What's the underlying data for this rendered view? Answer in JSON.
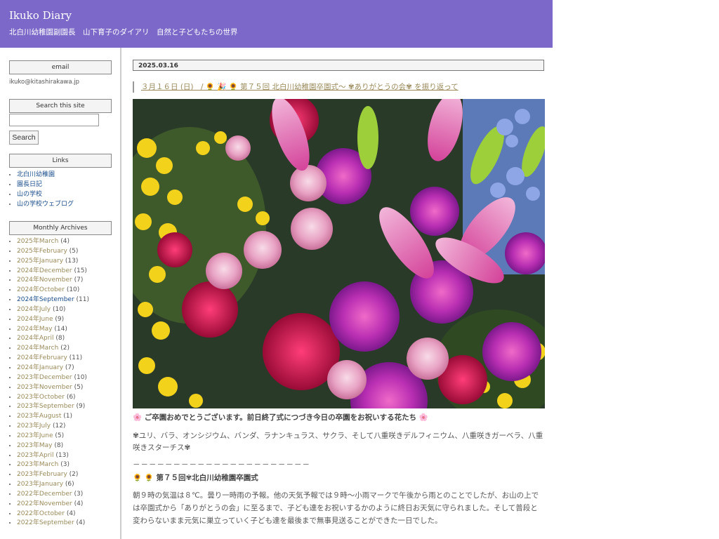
{
  "header": {
    "title": "Ikuko Diary",
    "tagline": "北白川幼稚園副園長　山下育子のダイアリ　自然と子どもたちの世界"
  },
  "sidebar": {
    "email": {
      "heading": "email",
      "address": "ikuko@kitashirakawa.jp"
    },
    "search": {
      "heading": "Search this site",
      "button": "Search",
      "value": ""
    },
    "links": {
      "heading": "Links",
      "items": [
        "北白川幼稚園",
        "園長日記",
        "山の学校",
        "山の学校ウェブログ"
      ]
    },
    "archives": {
      "heading": "Monthly Archives",
      "items": [
        {
          "label": "2025年March",
          "count": "(4)"
        },
        {
          "label": "2025年February",
          "count": "(5)"
        },
        {
          "label": "2025年January",
          "count": "(13)"
        },
        {
          "label": "2024年December",
          "count": "(15)"
        },
        {
          "label": "2024年November",
          "count": "(7)"
        },
        {
          "label": "2024年October",
          "count": "(10)"
        },
        {
          "label": "2024年September",
          "count": "(11)"
        },
        {
          "label": "2024年July",
          "count": "(10)"
        },
        {
          "label": "2024年June",
          "count": "(9)"
        },
        {
          "label": "2024年May",
          "count": "(14)"
        },
        {
          "label": "2024年April",
          "count": "(8)"
        },
        {
          "label": "2024年March",
          "count": "(2)"
        },
        {
          "label": "2024年February",
          "count": "(11)"
        },
        {
          "label": "2024年January",
          "count": "(7)"
        },
        {
          "label": "2023年December",
          "count": "(10)"
        },
        {
          "label": "2023年November",
          "count": "(5)"
        },
        {
          "label": "2023年October",
          "count": "(6)"
        },
        {
          "label": "2023年September",
          "count": "(9)"
        },
        {
          "label": "2023年August",
          "count": "(1)"
        },
        {
          "label": "2023年July",
          "count": "(12)"
        },
        {
          "label": "2023年June",
          "count": "(5)"
        },
        {
          "label": "2023年May",
          "count": "(8)"
        },
        {
          "label": "2023年April",
          "count": "(13)"
        },
        {
          "label": "2023年March",
          "count": "(3)"
        },
        {
          "label": "2023年February",
          "count": "(2)"
        },
        {
          "label": "2023年January",
          "count": "(6)"
        },
        {
          "label": "2022年December",
          "count": "(3)"
        },
        {
          "label": "2022年November",
          "count": "(4)"
        },
        {
          "label": "2022年October",
          "count": "(4)"
        },
        {
          "label": "2022年September",
          "count": "(4)"
        }
      ]
    }
  },
  "entry": {
    "date": "2025.03.16",
    "title": "３月１６日 (日)　/ 🌻 🎉 🌻 第７５回 北白川幼稚園卒園式～ ✾ありがとうの会✾ を振り返って",
    "caption": "🌸 ご卒園おめでとうございます。前日終了式につづき今日の卒園をお祝いする花たち 🌸",
    "flowers": "✾ユリ、バラ、オンシジウム、バンダ、ラナンキュラス、サクラ、そして八重咲きデルフィニウム、八重咲きガーベラ、八重咲きスターチス✾",
    "divider": "－－－－－－－－－－－－－－－－－－－－－－",
    "section_heading": "🌻 🌻 第７５回✾北白川幼稚園卒園式",
    "body": "朝９時の気温は８℃。曇り一時雨の予報。他の天気予報では９時～小雨マークで午後から雨とのことでしたが、お山の上では卒園式から「ありがとうの会」に至るまで、子ども達をお祝いするかのように終日お天気に守られました。そして普段と変わらないまま元気に巣立っていく子ども達を最後まで無事見送ることができた一日でした。"
  },
  "colors": {
    "header_bg": "#7b68c8",
    "link_visited": "#1a4d8c",
    "link": "#9a8a5a"
  }
}
